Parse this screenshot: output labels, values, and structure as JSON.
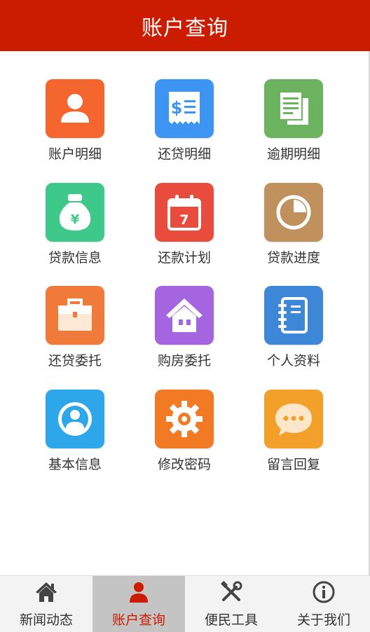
{
  "header": {
    "title": "账户查询"
  },
  "colors": {
    "brand": "#cc1c00",
    "tab_active_bg": "#c4c4c4"
  },
  "grid": [
    {
      "label": "账户明细",
      "icon": "user-icon",
      "color": "#f5662e"
    },
    {
      "label": "还贷明细",
      "icon": "receipt-icon",
      "color": "#3d94f2"
    },
    {
      "label": "逾期明细",
      "icon": "documents-icon",
      "color": "#6bb35f"
    },
    {
      "label": "贷款信息",
      "icon": "money-bag-icon",
      "color": "#3ec98a"
    },
    {
      "label": "还款计划",
      "icon": "calendar-icon",
      "color": "#e94b3c"
    },
    {
      "label": "贷款进度",
      "icon": "pie-chart-icon",
      "color": "#c0915c"
    },
    {
      "label": "还贷委托",
      "icon": "briefcase-icon",
      "color": "#f07a3a"
    },
    {
      "label": "购房委托",
      "icon": "house-icon",
      "color": "#a564e0"
    },
    {
      "label": "个人资料",
      "icon": "notebook-icon",
      "color": "#3d87d9"
    },
    {
      "label": "基本信息",
      "icon": "profile-circle-icon",
      "color": "#2ea6ea"
    },
    {
      "label": "修改密码",
      "icon": "gear-icon",
      "color": "#f27a25"
    },
    {
      "label": "留言回复",
      "icon": "chat-bubble-icon",
      "color": "#f3a02a"
    }
  ],
  "calendar_day": "7",
  "money_symbol": "¥",
  "receipt_symbol": "$",
  "tabs": [
    {
      "label": "新闻动态",
      "icon": "home-icon",
      "active": false
    },
    {
      "label": "账户查询",
      "icon": "person-icon",
      "active": true
    },
    {
      "label": "便民工具",
      "icon": "tools-icon",
      "active": false
    },
    {
      "label": "关于我们",
      "icon": "info-icon",
      "active": false
    }
  ]
}
